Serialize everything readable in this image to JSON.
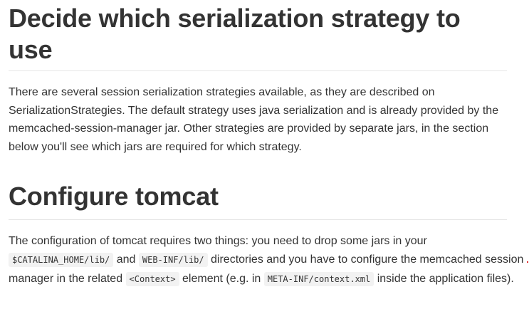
{
  "section1": {
    "heading": "Decide which serialization strategy to use",
    "paragraph": "There are several session serialization strategies available, as they are described on SerializationStrategies. The default strategy uses java serialization and is already provided by the memcached-session-manager jar. Other strategies are provided by separate jars, in the section below you'll see which jars are required for which strategy."
  },
  "section2": {
    "heading": "Configure tomcat",
    "paragraph": {
      "t1": "The configuration of tomcat requires two things: you need to drop some jars in your ",
      "code1": "$CATALINA_HOME/lib/",
      "t2": " and ",
      "code2": "WEB-INF/lib/",
      "t3": " directories and you have to configure the memcached session manager in the related ",
      "code3": "<Context>",
      "t4": " element (e.g. in ",
      "code4": "META-INF/context.xml",
      "t5": " inside the application files)."
    }
  }
}
